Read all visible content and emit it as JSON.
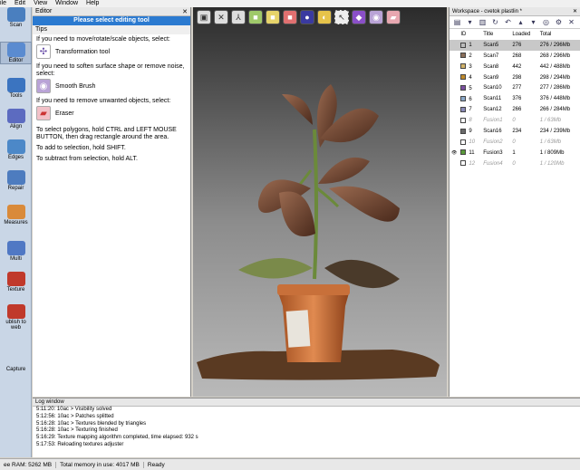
{
  "menu": [
    "ile",
    "Edit",
    "View",
    "Window",
    "Help"
  ],
  "sidebar": [
    {
      "label": "Scan",
      "color": "#4a7fbf",
      "icon": "scan-icon"
    },
    {
      "label": "Editor",
      "color": "#5a8bd0",
      "icon": "editor-icon"
    },
    {
      "label": "Tools",
      "color": "#3b74c0",
      "icon": "tools-icon"
    },
    {
      "label": "Align",
      "color": "#5c6bc0",
      "icon": "align-icon"
    },
    {
      "label": "Edges",
      "color": "#4c88c8",
      "icon": "edges-icon"
    },
    {
      "label": "Repair",
      "color": "#4d7cbf",
      "icon": "repair-icon"
    },
    {
      "label": "Measures",
      "color": "#d98a3a",
      "icon": "measures-icon"
    },
    {
      "label": "Multi",
      "color": "#5078c4",
      "icon": "multi-icon"
    },
    {
      "label": "Texture",
      "color": "#c0392b",
      "icon": "texture-icon"
    },
    {
      "label": "ublish to web",
      "color": "#c0392b",
      "icon": "publish-icon"
    },
    {
      "label": "Capture",
      "color": "#c9d6e6",
      "icon": "capture-icon"
    }
  ],
  "editor": {
    "title": "Editor",
    "select_prompt": "Please select editing tool",
    "tips": "Tips",
    "transform_hint": "If you need to move/rotate/scale objects, select:",
    "transform_tool": "Transformation tool",
    "smooth_hint": "If you need to soften surface shape or remove noise, select:",
    "smooth_tool": "Smooth Brush",
    "erase_hint": "If you need to remove unwanted objects, select:",
    "erase_tool": "Eraser",
    "select_help": "To select polygons, hold CTRL and LEFT MOUSE BUTTON, then drag rectangle around the area.",
    "add_help": "To add to selection, hold SHIFT.",
    "subtract_help": "To subtract from selection, hold ALT."
  },
  "workspace": {
    "title": "Workspace - cvetok plastlin *",
    "columns": [
      "ID",
      "Title",
      "Loaded",
      "Total"
    ],
    "rows": [
      {
        "id": "1",
        "title": "Scan5",
        "loaded": "276",
        "total": "276 / 296Mb",
        "color": "#bbbbbb",
        "selected": true,
        "dim": false,
        "eye": false
      },
      {
        "id": "2",
        "title": "Scan7",
        "loaded": "268",
        "total": "268 / 296Mb",
        "color": "#8a6f5a",
        "selected": false,
        "dim": false,
        "eye": false
      },
      {
        "id": "3",
        "title": "Scan8",
        "loaded": "442",
        "total": "442 / 488Mb",
        "color": "#d1b26a",
        "selected": false,
        "dim": false,
        "eye": false
      },
      {
        "id": "4",
        "title": "Scan9",
        "loaded": "298",
        "total": "298 / 294Mb",
        "color": "#c08a2a",
        "selected": false,
        "dim": false,
        "eye": false
      },
      {
        "id": "5",
        "title": "Scan10",
        "loaded": "277",
        "total": "277 / 286Mb",
        "color": "#7b4fa0",
        "selected": false,
        "dim": false,
        "eye": false
      },
      {
        "id": "6",
        "title": "Scan11",
        "loaded": "376",
        "total": "376 / 448Mb",
        "color": "#8aa8c8",
        "selected": false,
        "dim": false,
        "eye": false
      },
      {
        "id": "7",
        "title": "Scan12",
        "loaded": "266",
        "total": "266 / 284Mb",
        "color": "#8a8ab8",
        "selected": false,
        "dim": false,
        "eye": false
      },
      {
        "id": "8",
        "title": "Fusion1",
        "loaded": "0",
        "total": "1 / 63Mb",
        "color": "#ffffff",
        "selected": false,
        "dim": true,
        "eye": false
      },
      {
        "id": "9",
        "title": "Scan16",
        "loaded": "234",
        "total": "234 / 239Mb",
        "color": "#6a6a6a",
        "selected": false,
        "dim": false,
        "eye": false
      },
      {
        "id": "10",
        "title": "Fusion2",
        "loaded": "0",
        "total": "1 / 63Mb",
        "color": "#ffffff",
        "selected": false,
        "dim": true,
        "eye": false
      },
      {
        "id": "11",
        "title": "Fusion3",
        "loaded": "1",
        "total": "1 / 809Mb",
        "color": "#5a9a3a",
        "selected": false,
        "dim": false,
        "eye": true
      },
      {
        "id": "12",
        "title": "Fusion4",
        "loaded": "0",
        "total": "1 / 120Mb",
        "color": "#ffffff",
        "selected": false,
        "dim": true,
        "eye": false
      }
    ]
  },
  "log": {
    "title": "Log window",
    "lines": [
      "5:11:20: 10ac > Visibility solved",
      "5:12:56: 10ac > Patches splitted",
      "5:16:28: 10ac > Textures blended by triangles",
      "5:16:28: 10ac > Texturing finished",
      "5:16:29: Texture mapping algorithm completed, time elapsed: 932 s",
      "5:17:53: Reloading textures adjuster"
    ]
  },
  "status": {
    "ram": "ee RAM: 5262 MB",
    "memory": "Total memory in use: 4017 MB",
    "state": "Ready"
  }
}
